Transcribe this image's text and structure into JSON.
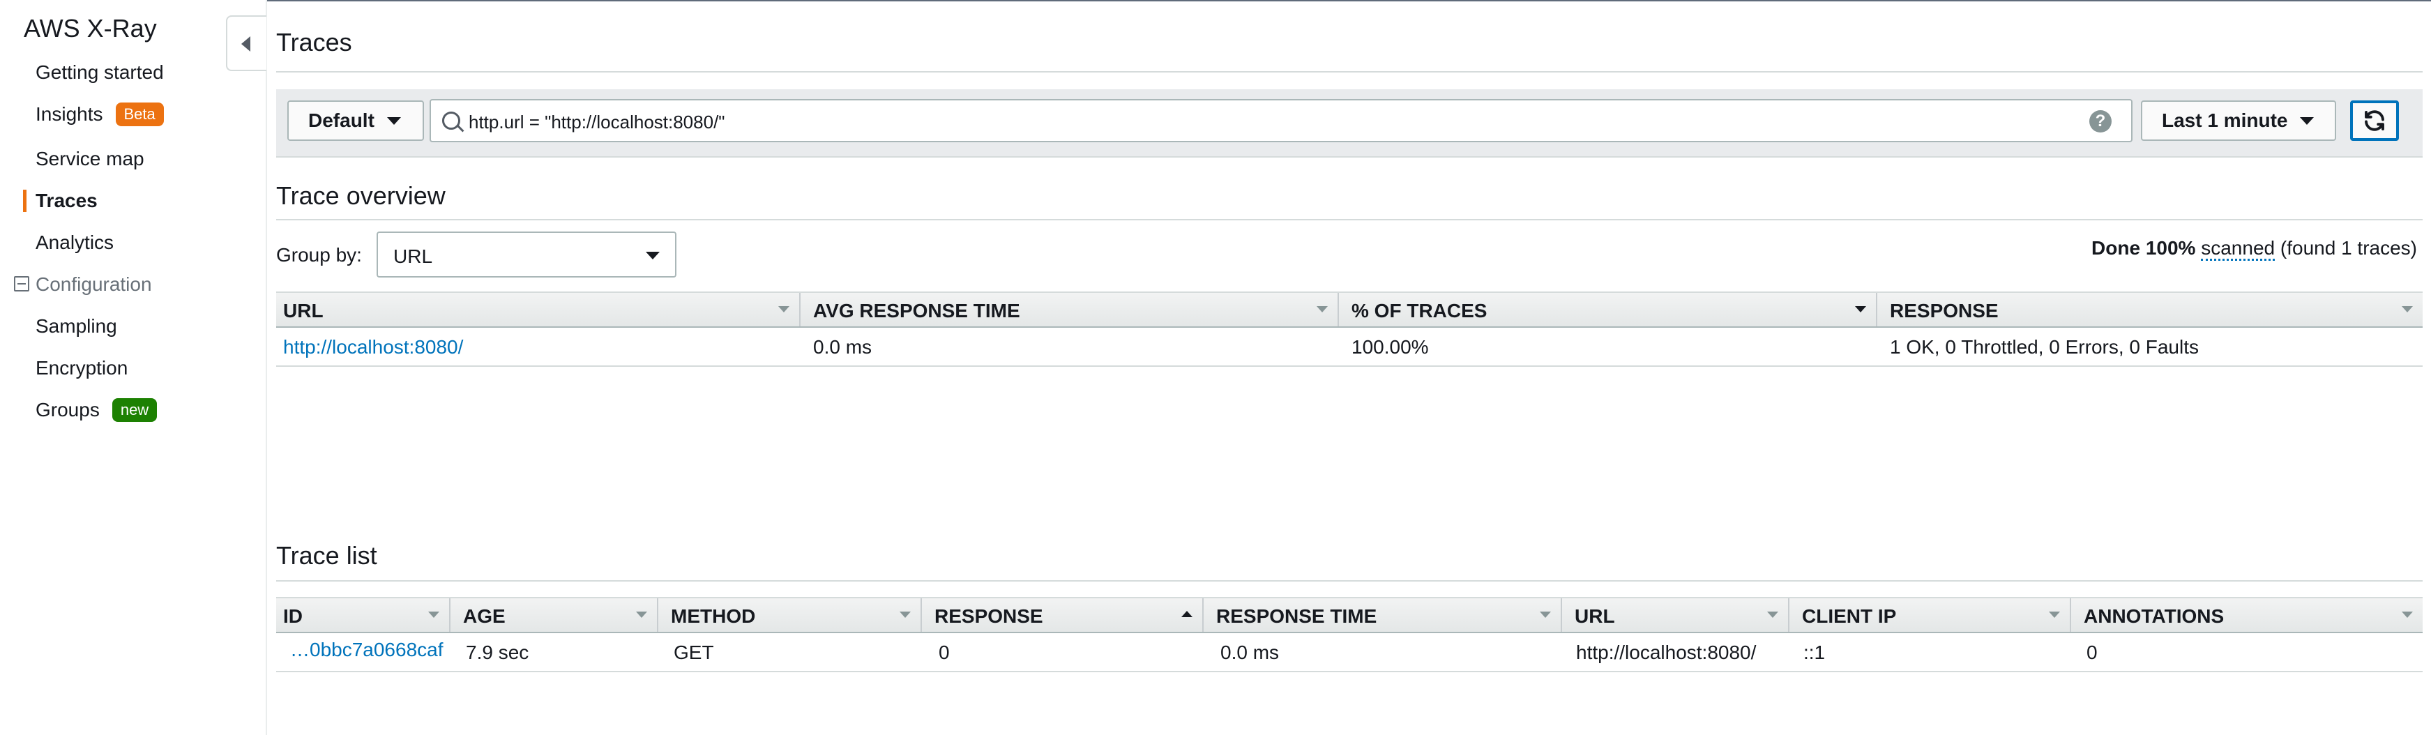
{
  "sidebar": {
    "title": "AWS X-Ray",
    "items": [
      {
        "label": "Getting started"
      },
      {
        "label": "Insights",
        "badge": "Beta"
      },
      {
        "label": "Service map"
      },
      {
        "label": "Traces"
      },
      {
        "label": "Analytics"
      },
      {
        "label": "Configuration"
      },
      {
        "label": "Sampling"
      },
      {
        "label": "Encryption"
      },
      {
        "label": "Groups",
        "badge": "new"
      }
    ],
    "active_item": "Traces"
  },
  "page": {
    "title": "Traces"
  },
  "toolbar": {
    "group_label": "Default",
    "filter_expression": "http.url = \"http://localhost:8080/\"",
    "time_range_label": "Last 1 minute",
    "help_glyph": "?"
  },
  "trace_overview": {
    "title": "Trace overview",
    "group_by_label": "Group by:",
    "group_by_value": "URL",
    "status_prefix": "Done",
    "status_percent": "100%",
    "status_scanned": "scanned",
    "status_suffix": "(found 1 traces)",
    "columns": [
      "URL",
      "AVG RESPONSE TIME",
      "% OF TRACES",
      "RESPONSE"
    ],
    "rows": [
      [
        "http://localhost:8080/",
        "0.0 ms",
        "100.00%",
        "1 OK, 0 Throttled, 0 Errors, 0 Faults"
      ]
    ]
  },
  "trace_list": {
    "title": "Trace list",
    "columns": [
      "ID",
      "AGE",
      "METHOD",
      "RESPONSE",
      "RESPONSE TIME",
      "URL",
      "CLIENT IP",
      "ANNOTATIONS"
    ],
    "rows": [
      [
        "…0bbc7a0668caf",
        "7.9 sec",
        "GET",
        "0",
        "0.0 ms",
        "http://localhost:8080/",
        "::1",
        "0"
      ]
    ]
  },
  "colors": {
    "accent_orange": "#ec7211",
    "link_blue": "#0073bb",
    "badge_green": "#1d8102"
  }
}
